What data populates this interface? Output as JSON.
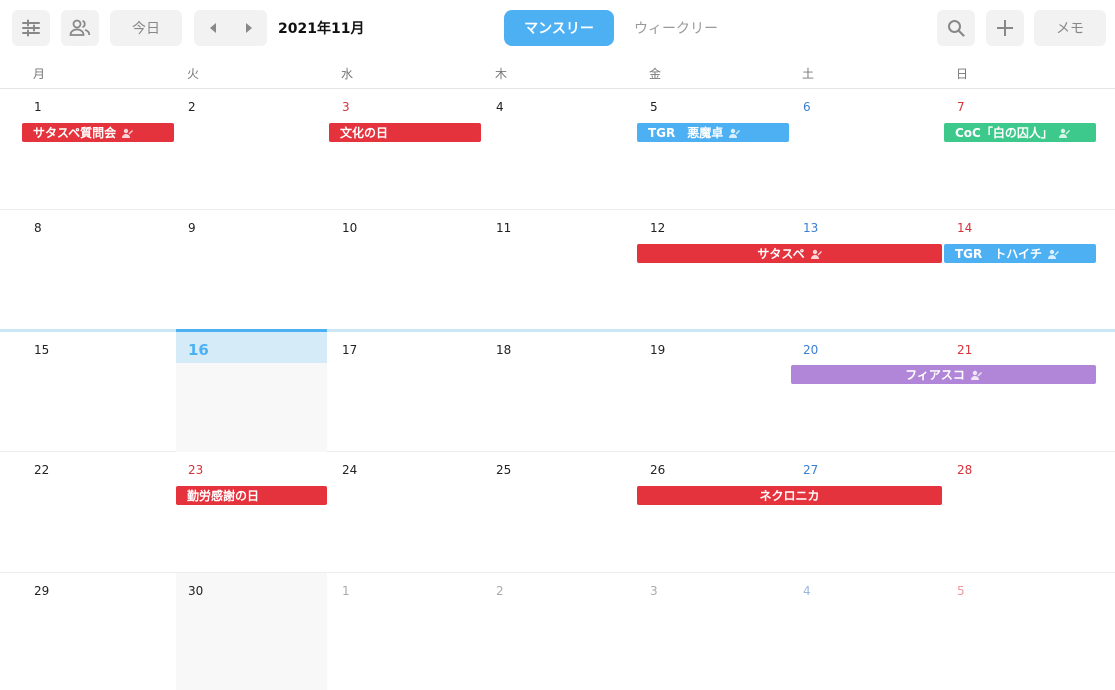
{
  "toolbar": {
    "today_label": "今日",
    "month_title": "2021年11月",
    "monthly_label": "マンスリー",
    "weekly_label": "ウィークリー",
    "memo_label": "メモ",
    "icons": [
      "filter-icon",
      "members-icon",
      "chevron-left-icon",
      "chevron-right-icon",
      "search-icon",
      "plus-icon"
    ],
    "accent_color": "#4db0f3"
  },
  "weekdays": [
    "月",
    "火",
    "水",
    "木",
    "金",
    "土",
    "日"
  ],
  "weeks": [
    {
      "days": [
        "1",
        "2",
        "3",
        "4",
        "5",
        "6",
        "7"
      ]
    },
    {
      "days": [
        "8",
        "9",
        "10",
        "11",
        "12",
        "13",
        "14"
      ]
    },
    {
      "days": [
        "15",
        "16",
        "17",
        "18",
        "19",
        "20",
        "21"
      ]
    },
    {
      "days": [
        "22",
        "23",
        "24",
        "25",
        "26",
        "27",
        "28"
      ]
    },
    {
      "days": [
        "29",
        "30",
        "1",
        "2",
        "3",
        "4",
        "5"
      ]
    }
  ],
  "events": {
    "e1": "サタスペ質問会",
    "e2": "文化の日",
    "e3": "TGR　悪魔卓",
    "e4": "CoC「白の囚人」",
    "e5": "サタスペ",
    "e6": "TGR　トハイチ",
    "e7": "フィアスコ",
    "e8": "勤労感謝の日",
    "e9": "ネクロニカ"
  },
  "colors": {
    "red": "#e5333d",
    "blue": "#4db0f3",
    "green": "#3ec98c",
    "purple": "#b186d9"
  }
}
